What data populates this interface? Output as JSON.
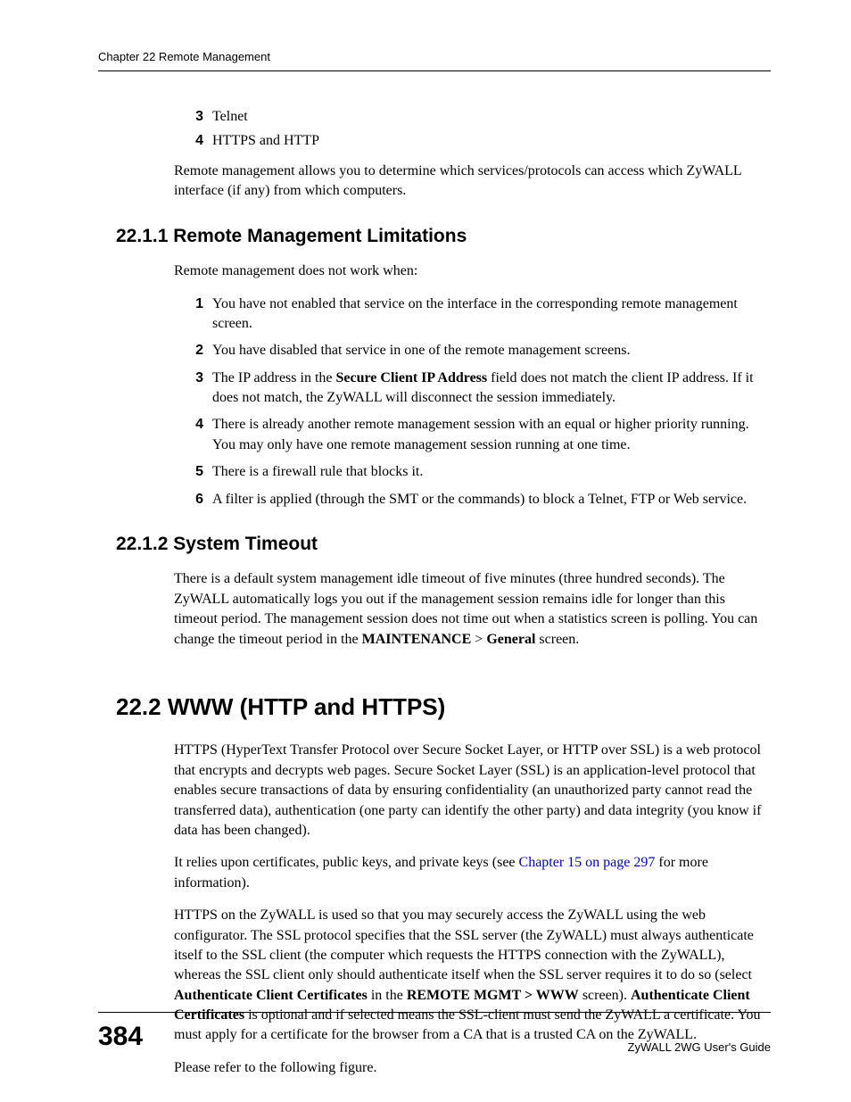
{
  "header": {
    "chapter": "Chapter 22 Remote Management"
  },
  "continued_list": [
    {
      "num": "3",
      "text": "Telnet"
    },
    {
      "num": "4",
      "text": "HTTPS and HTTP"
    }
  ],
  "intro_para": "Remote management allows you to determine which services/protocols can access which ZyWALL interface (if any) from which computers.",
  "section_22_1_1": {
    "heading": "22.1.1  Remote Management Limitations",
    "intro": "Remote management does not work when:",
    "items": [
      {
        "num": "1",
        "text": "You have not enabled that service on the interface in the corresponding remote management screen."
      },
      {
        "num": "2",
        "text": "You have disabled that service in one of the remote management screens."
      },
      {
        "num": "3",
        "pre": "The IP address in the ",
        "bold": "Secure Client IP Address",
        "post": " field does not match the client IP address. If it does not match, the ZyWALL will disconnect the session immediately."
      },
      {
        "num": "4",
        "text": "There is already another remote management session with an equal or higher priority running. You may only have one remote management session running at one time."
      },
      {
        "num": "5",
        "text": "There is a firewall rule that blocks it."
      },
      {
        "num": "6",
        "text": "A filter is applied (through the SMT or the commands) to block a Telnet, FTP or Web service."
      }
    ]
  },
  "section_22_1_2": {
    "heading": "22.1.2  System Timeout",
    "para_pre": "There is a default system management idle timeout of five minutes (three hundred seconds). The ZyWALL automatically logs you out if the management session remains idle for longer than this timeout period. The management session does not time out when a statistics screen is polling. You can change the timeout period in the ",
    "bold1": "MAINTENANCE",
    "sep": " > ",
    "bold2": "General",
    "para_post": " screen."
  },
  "section_22_2": {
    "heading": "22.2  WWW (HTTP and HTTPS)",
    "para1": "HTTPS (HyperText Transfer Protocol over Secure Socket Layer, or HTTP over SSL) is a web protocol that encrypts and decrypts web pages. Secure Socket Layer (SSL) is an application-level protocol that enables secure transactions of data by ensuring confidentiality (an unauthorized party cannot read the transferred data), authentication (one party can identify the other party) and data integrity (you know if data has been changed).",
    "para2_pre": "It relies upon certificates, public keys, and private keys (see ",
    "para2_link": "Chapter 15 on page 297",
    "para2_post": " for more information).",
    "para3_pre": "HTTPS on the ZyWALL is used so that you may securely access the ZyWALL using the web configurator. The SSL protocol specifies that the SSL server (the ZyWALL) must always authenticate itself to the SSL client (the computer which requests the HTTPS connection with the ZyWALL), whereas the SSL client only should authenticate itself when the SSL server requires it to do so (select ",
    "para3_b1": "Authenticate Client Certificates",
    "para3_mid1": " in the ",
    "para3_b2": "REMOTE MGMT > WWW",
    "para3_mid2": " screen). ",
    "para3_b3": "Authenticate Client Certificates",
    "para3_post": " is optional and if selected means the SSL-client must send the ZyWALL a certificate. You must apply for a certificate for the browser from a CA that is a trusted CA on the ZyWALL.",
    "para4": "Please refer to the following figure."
  },
  "footer": {
    "page": "384",
    "guide": "ZyWALL 2WG User's Guide"
  }
}
